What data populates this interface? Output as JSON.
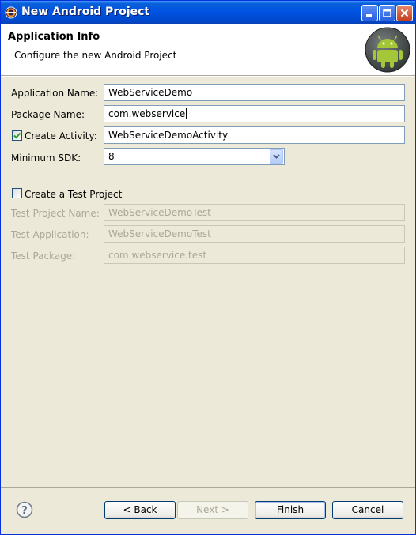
{
  "window": {
    "title": "New Android Project"
  },
  "header": {
    "title": "Application Info",
    "description": "Configure the new Android Project"
  },
  "form": {
    "app_name_label": "Application Name:",
    "app_name_value": "WebServiceDemo",
    "package_label": "Package Name:",
    "package_value": "com.webservice",
    "create_activity_label": "Create Activity:",
    "create_activity_checked": true,
    "create_activity_value": "WebServiceDemoActivity",
    "min_sdk_label": "Minimum SDK:",
    "min_sdk_value": "8"
  },
  "test_project": {
    "checkbox_label": "Create a Test Project",
    "checked": false,
    "name_label": "Test Project Name:",
    "name_value": "WebServiceDemoTest",
    "app_label": "Test Application:",
    "app_value": "WebServiceDemoTest",
    "package_label": "Test Package:",
    "package_value": "com.webservice.test"
  },
  "buttons": {
    "back": "< Back",
    "next": "Next >",
    "finish": "Finish",
    "cancel": "Cancel"
  },
  "colors": {
    "titlebar": "#0054e3",
    "dialog_bg": "#ece9d8",
    "header_bg": "#ffffff",
    "android_green": "#a4c639"
  }
}
